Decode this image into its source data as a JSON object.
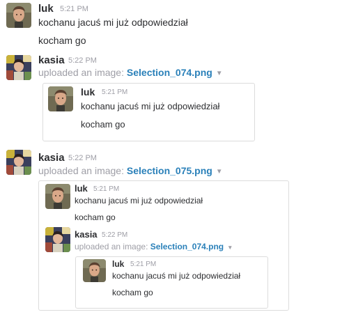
{
  "luk": {
    "name": "luk",
    "time": "5:21 PM",
    "line1": "kochanu  jacuś mi już odpowiedział",
    "line2": "kocham go"
  },
  "kasia_first": {
    "name": "kasia",
    "time": "5:22 PM",
    "upload_prefix": "uploaded an image:",
    "file": "Selection_074.png"
  },
  "kasia_second": {
    "name": "kasia",
    "time": "5:22 PM",
    "upload_prefix": "uploaded an image:",
    "file": "Selection_075.png"
  },
  "icons": {
    "avatar_luk": "avatar-photo",
    "avatar_kasia": "avatar-photo",
    "file_menu": "chevron-down-icon"
  },
  "colors": {
    "link": "#2a80b9",
    "meta": "#9e9ea6",
    "text": "#2c2d30",
    "border": "#dcdcdc"
  }
}
